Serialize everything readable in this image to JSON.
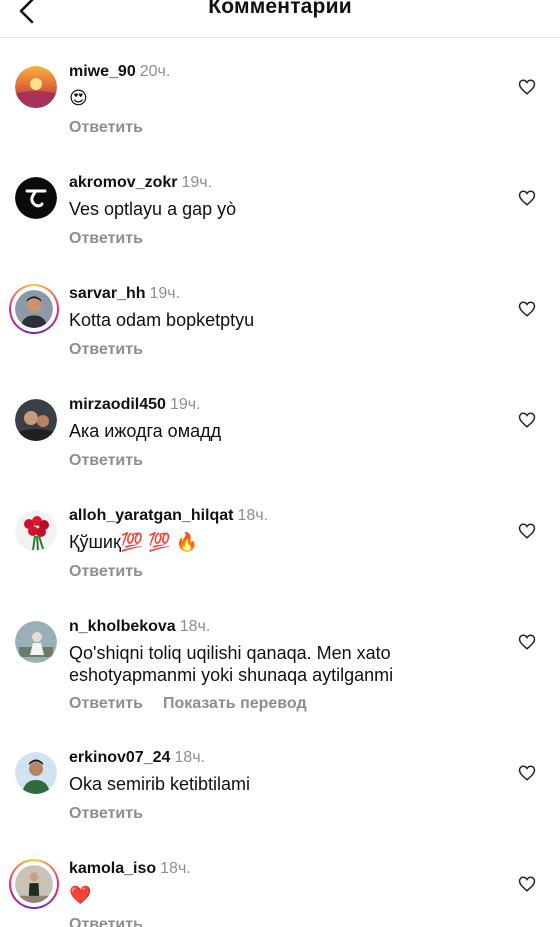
{
  "header": {
    "title": "Комментарии"
  },
  "comments": [
    {
      "username": "miwe_90",
      "time": "20ч.",
      "text": "😍",
      "reply": "Ответить"
    },
    {
      "username": "akromov_zokr",
      "time": "19ч.",
      "text": "Ves optlayu a gap yò",
      "reply": "Ответить"
    },
    {
      "username": "sarvar_hh",
      "time": "19ч.",
      "text": "Kotta odam bopketptyu",
      "reply": "Ответить"
    },
    {
      "username": "mirzaodil450",
      "time": "19ч.",
      "text": "Ака ижодга омадд",
      "reply": "Ответить"
    },
    {
      "username": "alloh_yaratgan_hilqat",
      "time": "18ч.",
      "text": "Қўшиқ💯 💯 🔥",
      "reply": "Ответить"
    },
    {
      "username": "n_kholbekova",
      "time": "18ч.",
      "text": "Qo'shiqni toliq uqilishi qanaqa. Men xato eshotyapmanmi yoki shunaqa aytilganmi",
      "reply": "Ответить",
      "translate": "Показать перевод"
    },
    {
      "username": "erkinov07_24",
      "time": "18ч.",
      "text": "Oka semirib ketibtilami",
      "reply": "Ответить"
    },
    {
      "username": "kamola_iso",
      "time": "18ч.",
      "text": "❤️",
      "reply": "Ответить"
    }
  ]
}
